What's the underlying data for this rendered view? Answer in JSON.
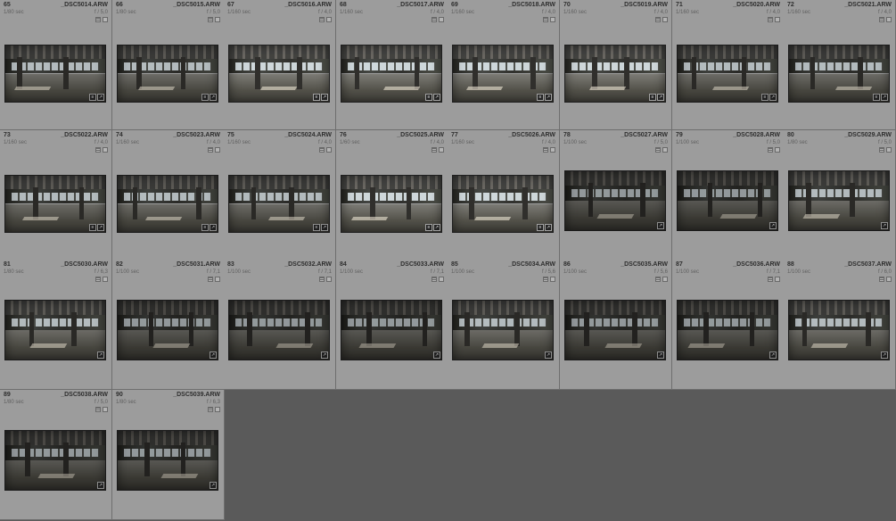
{
  "app": "Photo library grid view",
  "cells": [
    {
      "idx": "65",
      "filename": "_DSC5014.ARW",
      "shutter": "1/80 sec",
      "aperture": "f / 5,0",
      "thumb": "landscape",
      "tone": "normal",
      "overlays": [
        "metadata-icon",
        "crop-icon"
      ]
    },
    {
      "idx": "66",
      "filename": "_DSC5015.ARW",
      "shutter": "1/80 sec",
      "aperture": "f / 5,0",
      "thumb": "landscape",
      "tone": "normal",
      "overlays": [
        "metadata-icon",
        "crop-icon"
      ]
    },
    {
      "idx": "67",
      "filename": "_DSC5016.ARW",
      "shutter": "1/160 sec",
      "aperture": "f / 4,0",
      "thumb": "landscape",
      "tone": "bright",
      "overlays": [
        "metadata-icon",
        "crop-icon"
      ]
    },
    {
      "idx": "68",
      "filename": "_DSC5017.ARW",
      "shutter": "1/160 sec",
      "aperture": "f / 4,0",
      "thumb": "landscape",
      "tone": "bright",
      "overlays": [
        "metadata-icon",
        "crop-icon"
      ]
    },
    {
      "idx": "69",
      "filename": "_DSC5018.ARW",
      "shutter": "1/160 sec",
      "aperture": "f / 4,0",
      "thumb": "landscape",
      "tone": "bright",
      "overlays": [
        "metadata-icon",
        "crop-icon"
      ]
    },
    {
      "idx": "70",
      "filename": "_DSC5019.ARW",
      "shutter": "1/160 sec",
      "aperture": "f / 4,0",
      "thumb": "landscape",
      "tone": "bright",
      "overlays": [
        "metadata-icon",
        "crop-icon"
      ]
    },
    {
      "idx": "71",
      "filename": "_DSC5020.ARW",
      "shutter": "1/160 sec",
      "aperture": "f / 4,0",
      "thumb": "landscape",
      "tone": "normal",
      "overlays": [
        "metadata-icon",
        "crop-icon"
      ]
    },
    {
      "idx": "72",
      "filename": "_DSC5021.ARW",
      "shutter": "1/160 sec",
      "aperture": "f / 4,0",
      "thumb": "landscape",
      "tone": "normal",
      "overlays": [
        "metadata-icon",
        "crop-icon"
      ]
    },
    {
      "idx": "73",
      "filename": "_DSC5022.ARW",
      "shutter": "1/160 sec",
      "aperture": "f / 4,0",
      "thumb": "landscape",
      "tone": "normal",
      "overlays": [
        "metadata-icon",
        "crop-icon"
      ]
    },
    {
      "idx": "74",
      "filename": "_DSC5023.ARW",
      "shutter": "1/160 sec",
      "aperture": "f / 4,0",
      "thumb": "landscape",
      "tone": "normal",
      "overlays": [
        "metadata-icon",
        "crop-icon"
      ]
    },
    {
      "idx": "75",
      "filename": "_DSC5024.ARW",
      "shutter": "1/160 sec",
      "aperture": "f / 4,0",
      "thumb": "landscape",
      "tone": "normal",
      "overlays": [
        "metadata-icon",
        "crop-icon"
      ]
    },
    {
      "idx": "76",
      "filename": "_DSC5025.ARW",
      "shutter": "1/60 sec",
      "aperture": "f / 4,0",
      "thumb": "landscape",
      "tone": "bright",
      "overlays": [
        "metadata-icon",
        "crop-icon"
      ]
    },
    {
      "idx": "77",
      "filename": "_DSC5026.ARW",
      "shutter": "1/160 sec",
      "aperture": "f / 4,0",
      "thumb": "landscape",
      "tone": "bright",
      "overlays": [
        "metadata-icon",
        "crop-icon"
      ]
    },
    {
      "idx": "78",
      "filename": "_DSC5027.ARW",
      "shutter": "1/100 sec",
      "aperture": "f / 5,0",
      "thumb": "wide",
      "tone": "dark",
      "overlays": [
        "crop-icon"
      ]
    },
    {
      "idx": "79",
      "filename": "_DSC5028.ARW",
      "shutter": "1/100 sec",
      "aperture": "f / 5,0",
      "thumb": "wide",
      "tone": "dark",
      "overlays": [
        "crop-icon"
      ]
    },
    {
      "idx": "80",
      "filename": "_DSC5029.ARW",
      "shutter": "1/80 sec",
      "aperture": "f / 5,0",
      "thumb": "wide",
      "tone": "normal",
      "overlays": [
        "crop-icon"
      ]
    },
    {
      "idx": "81",
      "filename": "_DSC5030.ARW",
      "shutter": "1/80 sec",
      "aperture": "f / 6,3",
      "thumb": "wide",
      "tone": "normal",
      "overlays": [
        "crop-icon"
      ]
    },
    {
      "idx": "82",
      "filename": "_DSC5031.ARW",
      "shutter": "1/100 sec",
      "aperture": "f / 7,1",
      "thumb": "wide",
      "tone": "dark",
      "overlays": [
        "crop-icon"
      ]
    },
    {
      "idx": "83",
      "filename": "_DSC5032.ARW",
      "shutter": "1/100 sec",
      "aperture": "f / 7,1",
      "thumb": "wide",
      "tone": "dark",
      "overlays": [
        "crop-icon"
      ]
    },
    {
      "idx": "84",
      "filename": "_DSC5033.ARW",
      "shutter": "1/100 sec",
      "aperture": "f / 7,1",
      "thumb": "wide",
      "tone": "dark",
      "overlays": [
        "crop-icon"
      ]
    },
    {
      "idx": "85",
      "filename": "_DSC5034.ARW",
      "shutter": "1/100 sec",
      "aperture": "f / 5,6",
      "thumb": "wide",
      "tone": "normal",
      "overlays": [
        "crop-icon"
      ]
    },
    {
      "idx": "86",
      "filename": "_DSC5035.ARW",
      "shutter": "1/100 sec",
      "aperture": "f / 5,6",
      "thumb": "wide",
      "tone": "dark",
      "overlays": [
        "crop-icon"
      ]
    },
    {
      "idx": "87",
      "filename": "_DSC5036.ARW",
      "shutter": "1/100 sec",
      "aperture": "f / 7,1",
      "thumb": "wide",
      "tone": "dark",
      "overlays": [
        "crop-icon"
      ]
    },
    {
      "idx": "88",
      "filename": "_DSC5037.ARW",
      "shutter": "1/100 sec",
      "aperture": "f / 6,0",
      "thumb": "wide",
      "tone": "normal",
      "overlays": [
        "crop-icon"
      ]
    },
    {
      "idx": "89",
      "filename": "_DSC5038.ARW",
      "shutter": "1/80 sec",
      "aperture": "f / 5,0",
      "thumb": "wide",
      "tone": "dark",
      "overlays": [
        "crop-icon"
      ]
    },
    {
      "idx": "90",
      "filename": "_DSC5039.ARW",
      "shutter": "1/80 sec",
      "aperture": "f / 6,3",
      "thumb": "wide",
      "tone": "dark",
      "overlays": [
        "crop-icon"
      ]
    }
  ],
  "colors": {
    "background": "#5a5a5a",
    "cell": "#9c9c9c",
    "cell_border": "#6e6e6e",
    "text_primary": "#2e2e2e",
    "text_secondary": "#5f5f5f"
  }
}
